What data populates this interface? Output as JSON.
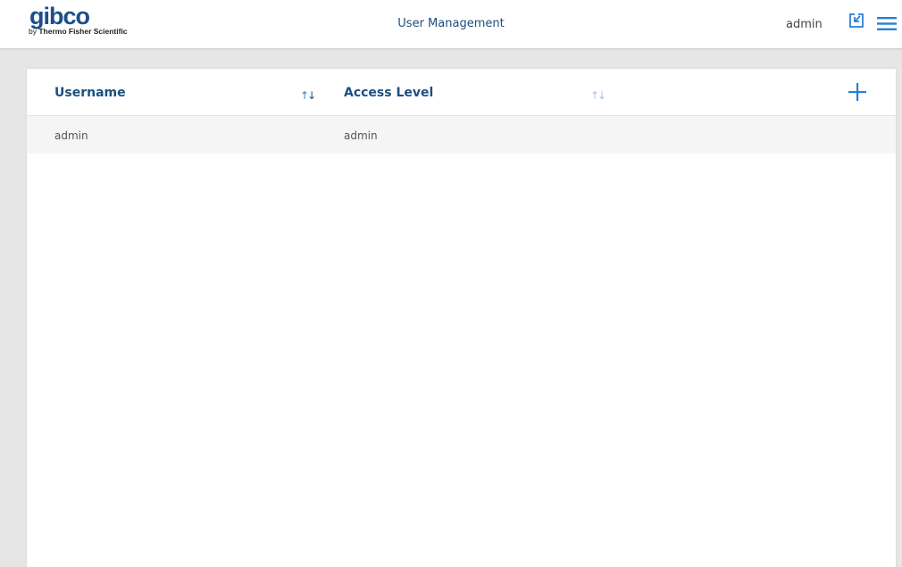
{
  "header": {
    "logo": {
      "main": "gibco",
      "sub_prefix": "by ",
      "sub_brand": "Thermo Fisher Scientific"
    },
    "title": "User Management",
    "current_user": "admin",
    "icons": {
      "logout": "logout-arrow-icon",
      "menu": "hamburger-menu-icon"
    },
    "accent_color": "#1b4f80",
    "icon_color": "#2b7fd4"
  },
  "table": {
    "columns": [
      {
        "label": "Username",
        "sort_icon": "sort-icon"
      },
      {
        "label": "Access Level",
        "sort_icon": "sort-icon"
      }
    ],
    "add_icon": "plus-icon",
    "rows": [
      {
        "username": "admin",
        "access_level": "admin"
      }
    ]
  }
}
